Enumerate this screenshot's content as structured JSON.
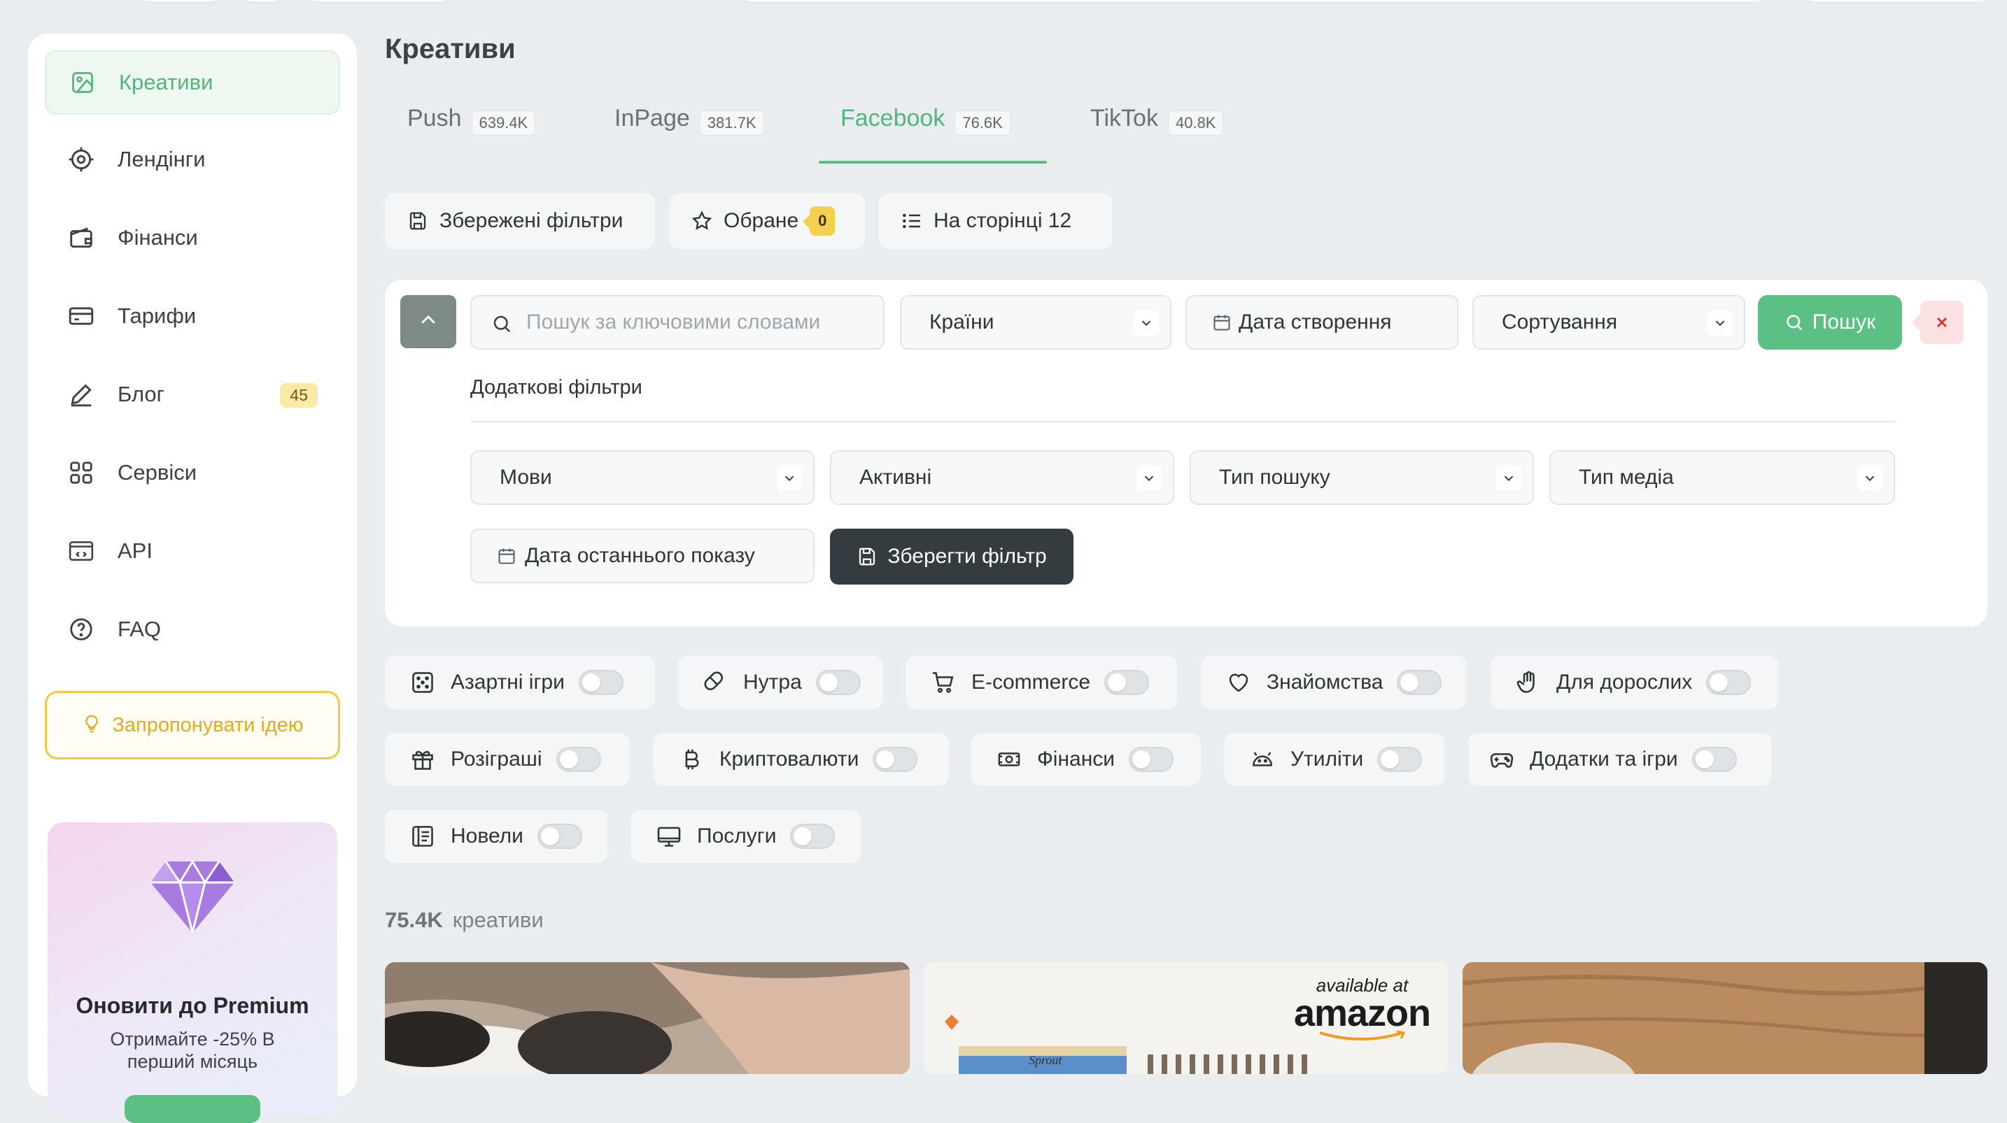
{
  "sidebar": {
    "items": [
      {
        "label": "Креативи",
        "icon": "image-icon",
        "active": true
      },
      {
        "label": "Лендінги",
        "icon": "target-icon"
      },
      {
        "label": "Фінанси",
        "icon": "wallet-icon"
      },
      {
        "label": "Тарифи",
        "icon": "credit-card-icon"
      },
      {
        "label": "Блог",
        "icon": "pen-icon",
        "badge": "45"
      },
      {
        "label": "Сервіси",
        "icon": "grid-icon"
      },
      {
        "label": "API",
        "icon": "api-icon"
      },
      {
        "label": "FAQ",
        "icon": "help-circle-icon"
      }
    ],
    "idea_label": "Запропонувати ідею",
    "premium": {
      "title": "Оновити до Premium",
      "subtitle": "Отримайте -25% В перший місяць"
    }
  },
  "main": {
    "title": "Креативи",
    "tabs": [
      {
        "label": "Push",
        "count": "639.4K"
      },
      {
        "label": "InPage",
        "count": "381.7K"
      },
      {
        "label": "Facebook",
        "count": "76.6K",
        "active": true
      },
      {
        "label": "TikTok",
        "count": "40.8K"
      }
    ],
    "toolbar": {
      "saved_filters": "Збережені фільтри",
      "favorites": "Обране",
      "favorites_count": "0",
      "per_page": "На сторінці 12"
    },
    "filters": {
      "search_placeholder": "Пошук за ключовими словами",
      "countries": "Країни",
      "created_date": "Дата створення",
      "sort": "Сортування",
      "search_button": "Пошук",
      "extra_title": "Додаткові фільтри",
      "languages": "Мови",
      "active": "Активні",
      "search_type": "Тип пошуку",
      "media_type": "Тип медіа",
      "last_shown": "Дата останнього показу",
      "save_filter": "Зберегти фільтр"
    },
    "categories": [
      {
        "label": "Азартні ігри",
        "icon": "dice-icon",
        "enabled": false
      },
      {
        "label": "Нутра",
        "icon": "pill-icon",
        "enabled": false
      },
      {
        "label": "E-commerce",
        "icon": "cart-icon",
        "enabled": false
      },
      {
        "label": "Знайомства",
        "icon": "heart-icon",
        "enabled": false
      },
      {
        "label": "Для дорослих",
        "icon": "hand-icon",
        "enabled": false
      },
      {
        "label": "Розіграші",
        "icon": "gift-icon",
        "enabled": false
      },
      {
        "label": "Криптовалюти",
        "icon": "bitcoin-icon",
        "enabled": false
      },
      {
        "label": "Фінанси",
        "icon": "cash-icon",
        "enabled": false
      },
      {
        "label": "Утиліти",
        "icon": "android-icon",
        "enabled": false
      },
      {
        "label": "Додатки та ігри",
        "icon": "gamepad-icon",
        "enabled": false
      },
      {
        "label": "Новели",
        "icon": "book-icon",
        "enabled": false
      },
      {
        "label": "Послуги",
        "icon": "monitor-icon",
        "enabled": false
      }
    ],
    "results": {
      "count": "75.4K",
      "label": "креативи"
    },
    "cards": [
      {
        "image": "cat-photo"
      },
      {
        "image": "amazon-product",
        "text1": "available at",
        "text2": "amazon",
        "brand": "Sprout"
      },
      {
        "image": "wood-jar-photo"
      }
    ]
  },
  "colors": {
    "accent": "#5cbf84",
    "dark": "#353c3f",
    "warning": "#f3c94a",
    "background": "#e9edf0"
  }
}
